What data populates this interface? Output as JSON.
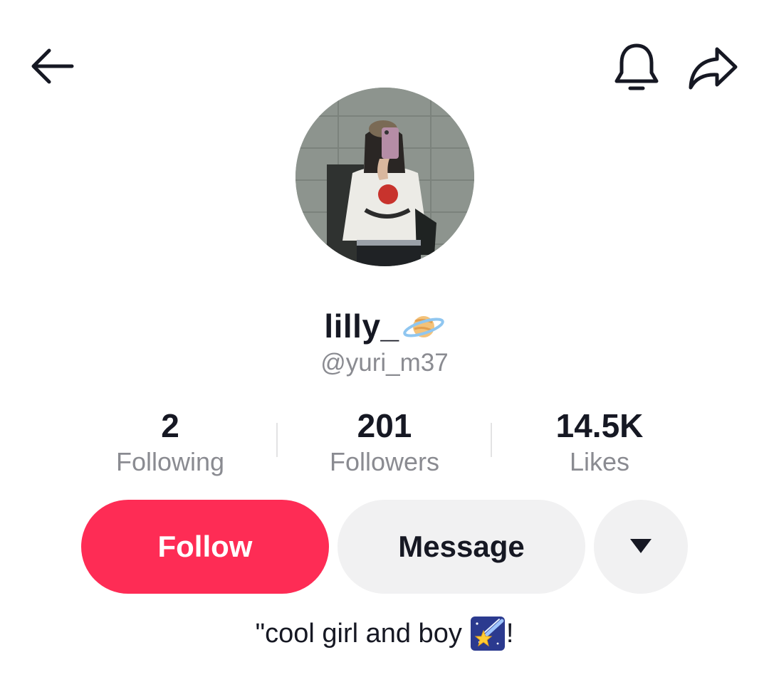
{
  "header": {
    "back_icon": "arrow-left-icon",
    "notification_icon": "bell-icon",
    "share_icon": "share-arrow-icon"
  },
  "profile": {
    "display_name": "lilly_",
    "display_name_emoji": "ringed-planet-emoji",
    "username": "@yuri_m37",
    "avatar": "profile-photo"
  },
  "stats": [
    {
      "value": "2",
      "label": "Following"
    },
    {
      "value": "201",
      "label": "Followers"
    },
    {
      "value": "14.5K",
      "label": "Likes"
    }
  ],
  "actions": {
    "follow_label": "Follow",
    "message_label": "Message",
    "more_icon": "caret-down-icon"
  },
  "bio": {
    "text": "\"cool girl and boy",
    "emoji": "shooting-star-emoji",
    "suffix": "!"
  },
  "colors": {
    "accent": "#fe2c55",
    "secondary_button_bg": "#f1f1f2",
    "muted_text": "#8a8b91",
    "text": "#161823"
  }
}
